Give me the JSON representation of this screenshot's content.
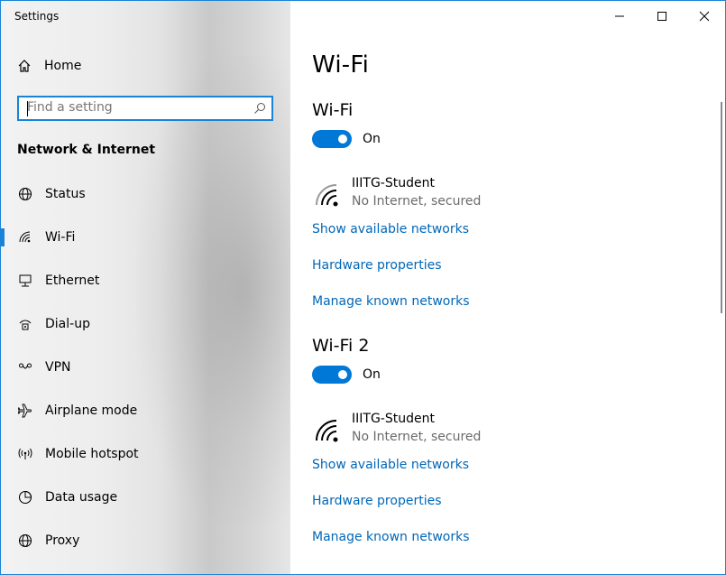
{
  "window": {
    "title": "Settings"
  },
  "sidebar": {
    "home_label": "Home",
    "search_placeholder": "Find a setting",
    "section_title": "Network & Internet",
    "items": [
      {
        "label": "Status",
        "icon": "globe-icon",
        "active": false
      },
      {
        "label": "Wi-Fi",
        "icon": "wifi-icon",
        "active": true
      },
      {
        "label": "Ethernet",
        "icon": "ethernet-icon",
        "active": false
      },
      {
        "label": "Dial-up",
        "icon": "dialup-icon",
        "active": false
      },
      {
        "label": "VPN",
        "icon": "vpn-icon",
        "active": false
      },
      {
        "label": "Airplane mode",
        "icon": "airplane-icon",
        "active": false
      },
      {
        "label": "Mobile hotspot",
        "icon": "hotspot-icon",
        "active": false
      },
      {
        "label": "Data usage",
        "icon": "data-usage-icon",
        "active": false
      },
      {
        "label": "Proxy",
        "icon": "proxy-globe-icon",
        "active": false
      }
    ]
  },
  "main": {
    "page_title": "Wi-Fi",
    "adapters": [
      {
        "title": "Wi-Fi",
        "toggle_state": "On",
        "network_name": "IIITG-Student",
        "network_status": "No Internet, secured",
        "links": [
          "Show available networks",
          "Hardware properties",
          "Manage known networks"
        ]
      },
      {
        "title": "Wi-Fi 2",
        "toggle_state": "On",
        "network_name": "IIITG-Student",
        "network_status": "No Internet, secured",
        "links": [
          "Show available networks",
          "Hardware properties",
          "Manage known networks"
        ]
      }
    ]
  },
  "colors": {
    "accent": "#0078d7",
    "link": "#0067b8",
    "border": "#1883d7"
  }
}
